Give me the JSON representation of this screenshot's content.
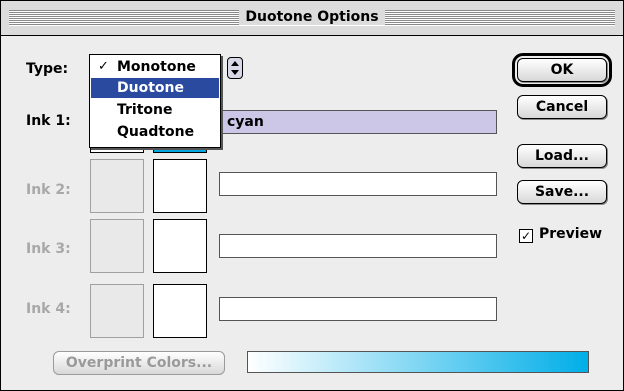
{
  "window": {
    "title": "Duotone Options"
  },
  "type_row": {
    "label": "Type:",
    "menu": [
      {
        "label": "Monotone",
        "checked": true,
        "highlighted": false
      },
      {
        "label": "Duotone",
        "checked": false,
        "highlighted": true
      },
      {
        "label": "Tritone",
        "checked": false,
        "highlighted": false
      },
      {
        "label": "Quadtone",
        "checked": false,
        "highlighted": false
      }
    ],
    "check_glyph": "✓"
  },
  "inks": [
    {
      "label": "Ink 1:",
      "name": "cyan",
      "enabled": true,
      "color_hex": "#00a6e0"
    },
    {
      "label": "Ink 2:",
      "name": "",
      "enabled": false
    },
    {
      "label": "Ink 3:",
      "name": "",
      "enabled": false
    },
    {
      "label": "Ink 4:",
      "name": "",
      "enabled": false
    }
  ],
  "buttons": {
    "ok": "OK",
    "cancel": "Cancel",
    "load": "Load...",
    "save": "Save...",
    "overprint": "Overprint Colors..."
  },
  "preview": {
    "label": "Preview",
    "checked": true,
    "check_glyph": "✓"
  },
  "gradient": {
    "from_hex": "#ffffff",
    "to_hex": "#00aee8"
  },
  "colors": {
    "highlight": "#2a4aa0",
    "ink_field": "#ccc7e6"
  }
}
